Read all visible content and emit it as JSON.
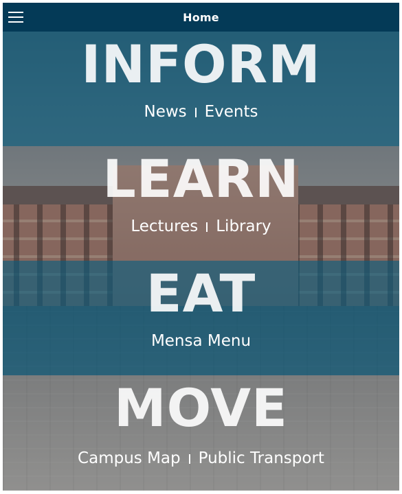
{
  "header": {
    "title": "Home",
    "menu_icon": "hamburger-menu-icon"
  },
  "tiles": [
    {
      "title": "INFORM",
      "links": [
        "News",
        "Events"
      ],
      "overlay_color": "#145a76"
    },
    {
      "title": "LEARN",
      "links": [
        "Lectures",
        "Library"
      ],
      "overlay_color": "#4b4e52"
    },
    {
      "title": "EAT",
      "links": [
        "Mensa Menu"
      ],
      "overlay_color": "#145a76"
    },
    {
      "title": "MOVE",
      "links": [
        "Campus Map",
        "Public Transport"
      ],
      "overlay_color": "#7d7d7d"
    }
  ],
  "colors": {
    "titlebar": "#043a57",
    "text": "#ffffff"
  }
}
